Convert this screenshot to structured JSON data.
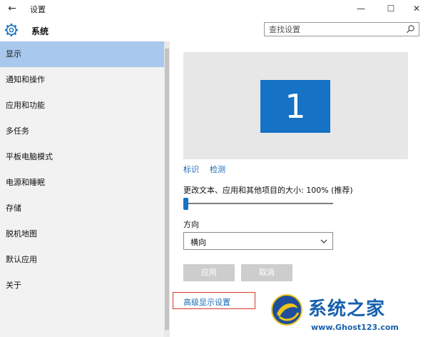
{
  "window": {
    "back_glyph": "←",
    "title": "设置",
    "controls": {
      "minimize": "—",
      "maximize": "☐",
      "close": "✕"
    }
  },
  "header": {
    "icon": "gear-icon",
    "title": "系统",
    "search": {
      "placeholder": "查找设置",
      "icon": "search-icon"
    }
  },
  "sidebar": {
    "items": [
      {
        "label": "显示",
        "active": true
      },
      {
        "label": "通知和操作"
      },
      {
        "label": "应用和功能"
      },
      {
        "label": "多任务"
      },
      {
        "label": "平板电脑模式"
      },
      {
        "label": "电源和睡眠"
      },
      {
        "label": "存储"
      },
      {
        "label": "脱机地图"
      },
      {
        "label": "默认应用"
      },
      {
        "label": "关于"
      }
    ]
  },
  "main": {
    "monitor_number": "1",
    "identify_link": "标识",
    "detect_link": "检测",
    "scale_label": "更改文本、应用和其他项目的大小: 100% (推荐)",
    "scale_percent": 0,
    "orientation_label": "方向",
    "orientation_value": "横向",
    "apply_button": "应用",
    "cancel_button": "取消",
    "advanced_link": "高级显示设置"
  },
  "watermark": {
    "title": "系统之家",
    "url": "www.Ghost123.com"
  },
  "colors": {
    "accent": "#1572c4",
    "sidebar_bg": "#f2f2f2",
    "sidebar_active": "#a8c9ed",
    "link": "#1b6ab3",
    "highlight_box": "#d3392b"
  }
}
